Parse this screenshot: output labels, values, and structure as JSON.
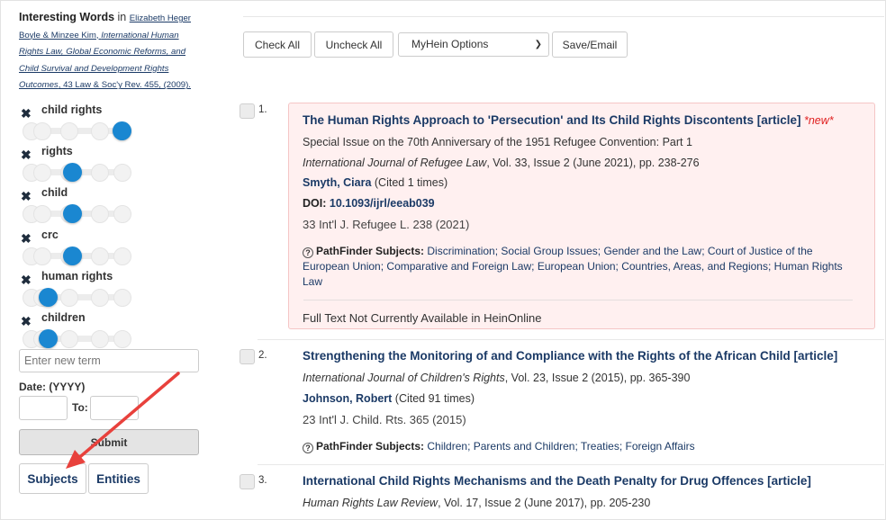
{
  "sidebar": {
    "heading_bold": "Interesting Words",
    "heading_in": " in ",
    "source_authors": "Elizabeth Heger Boyle & Minzee Kim, ",
    "source_title": "International Human Rights Law, Global Economic Reforms, and Child Survival and Development Rights Outcomes",
    "source_cite": ", 43 Law & Soc'y Rev. 455, (2009).",
    "terms": [
      {
        "label": "child rights",
        "weight": 5,
        "max": 5
      },
      {
        "label": "rights",
        "weight": 3,
        "max": 5
      },
      {
        "label": "child",
        "weight": 3,
        "max": 5
      },
      {
        "label": "crc",
        "weight": 3,
        "max": 5
      },
      {
        "label": "human rights",
        "weight": 2,
        "max": 5
      },
      {
        "label": "children",
        "weight": 2,
        "max": 5
      }
    ],
    "remove_icon": "close-x-icon",
    "new_term_placeholder": "Enter new term",
    "date_label": "Date: (YYYY)",
    "to_label": "To:",
    "submit_label": "Submit",
    "subjects_label": "Subjects",
    "entities_label": "Entities"
  },
  "toolbar": {
    "check_all": "Check All",
    "uncheck_all": "Uncheck All",
    "myhein_options": "MyHein Options",
    "save_email": "Save/Email"
  },
  "results": [
    {
      "number": "1.",
      "title": "The Human Rights Approach to 'Persecution' and Its Child Rights Discontents [article]",
      "new_tag": "*new*",
      "subtitle": "Special Issue on the 70th Anniversary of the 1951 Refugee Convention: Part 1",
      "journal": "International Journal of Refugee Law",
      "journal_rest": ", Vol. 33, Issue 2 (June 2021), pp. 238-276",
      "author": "Smyth, Ciara",
      "cited": " (Cited 1 times)",
      "doi_label": "DOI:",
      "doi": "10.1093/ijrl/eeab039",
      "citation": "33 Int'l J. Refugee L. 238 (2021)",
      "pathfinder_label": "PathFinder Subjects:",
      "subjects": "Discrimination; Social Group Issues; Gender and the Law; Court of Justice of the European Union; Comparative and Foreign Law; European Union; Countries, Areas, and Regions; Human Rights Law",
      "fulltext": "Full Text Not Currently Available in HeinOnline",
      "highlighted": true
    },
    {
      "number": "2.",
      "title": "Strengthening the Monitoring of and Compliance with the Rights of the African Child [article]",
      "journal": "International Journal of Children's Rights",
      "journal_rest": ", Vol. 23, Issue 2 (2015), pp. 365-390",
      "author": "Johnson, Robert",
      "cited": " (Cited 91 times)",
      "citation": "23 Int'l J. Child. Rts. 365 (2015)",
      "pathfinder_label": "PathFinder Subjects:",
      "subjects": "Children; Parents and Children; Treaties; Foreign Affairs"
    },
    {
      "number": "3.",
      "title": "International Child Rights Mechanisms and the Death Penalty for Drug Offences [article]",
      "journal": "Human Rights Law Review",
      "journal_rest": ", Vol. 17, Issue 2 (June 2017), pp. 205-230"
    }
  ],
  "annotation": {
    "arrow_color": "#e8413c",
    "points_to": "Subjects"
  }
}
